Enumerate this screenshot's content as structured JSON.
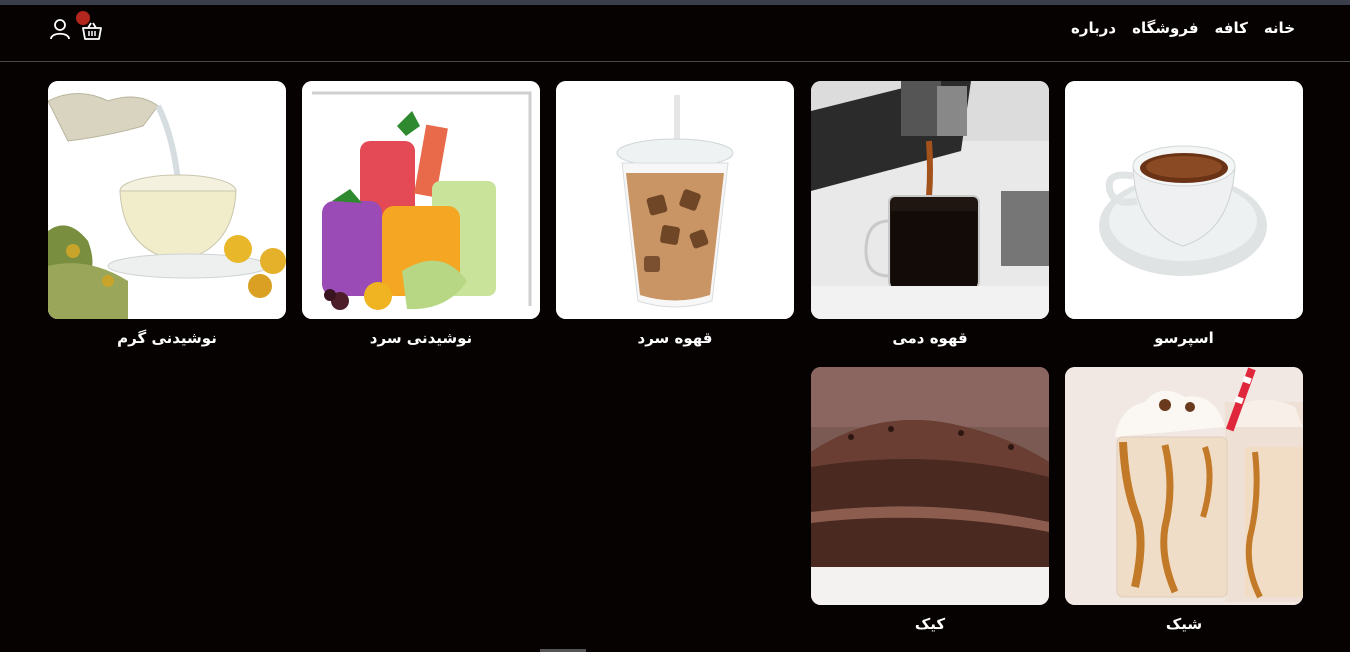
{
  "nav": {
    "items": [
      "خانه",
      "کافه",
      "فروشگاه",
      "درباره"
    ]
  },
  "colors": {
    "background": "#070202",
    "badge": "#b3261e",
    "card": "#ffffff"
  },
  "categories": [
    {
      "label": "اسپرسو"
    },
    {
      "label": "قهوه دمی"
    },
    {
      "label": "قهوه سرد"
    },
    {
      "label": "نوشیدنی سرد"
    },
    {
      "label": "نوشیدنی گرم"
    },
    {
      "label": "شیک"
    },
    {
      "label": "کیک"
    }
  ]
}
